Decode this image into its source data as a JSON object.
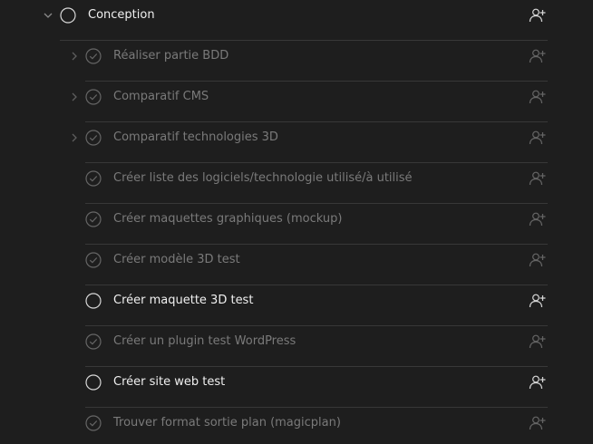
{
  "colors": {
    "background": "#1e1e1e",
    "divider": "#383838",
    "text_open": "#f0f0f0",
    "text_done": "#7a7a7a",
    "icon_open": "#d8d8d8",
    "icon_done": "#666666"
  },
  "parent_task": {
    "label": "Conception",
    "status": "open",
    "expanded": true,
    "icons": {
      "chevron": "chevron-down-icon",
      "status": "circle-icon",
      "assign": "add-user-icon"
    }
  },
  "subtasks": [
    {
      "label": "Réaliser partie BDD",
      "status": "done",
      "has_children": true
    },
    {
      "label": "Comparatif CMS",
      "status": "done",
      "has_children": true
    },
    {
      "label": "Comparatif technologies 3D",
      "status": "done",
      "has_children": true
    },
    {
      "label": "Créer liste des logiciels/technologie utilisé/à utilisé",
      "status": "done",
      "has_children": false
    },
    {
      "label": "Créer maquettes graphiques (mockup)",
      "status": "done",
      "has_children": false
    },
    {
      "label": "Créer modèle 3D test",
      "status": "done",
      "has_children": false
    },
    {
      "label": "Créer maquette 3D test",
      "status": "open",
      "has_children": false
    },
    {
      "label": "Créer un plugin test WordPress",
      "status": "done",
      "has_children": false
    },
    {
      "label": "Créer site web test",
      "status": "open",
      "has_children": false
    },
    {
      "label": "Trouver format sortie plan (magicplan)",
      "status": "done",
      "has_children": false
    }
  ]
}
